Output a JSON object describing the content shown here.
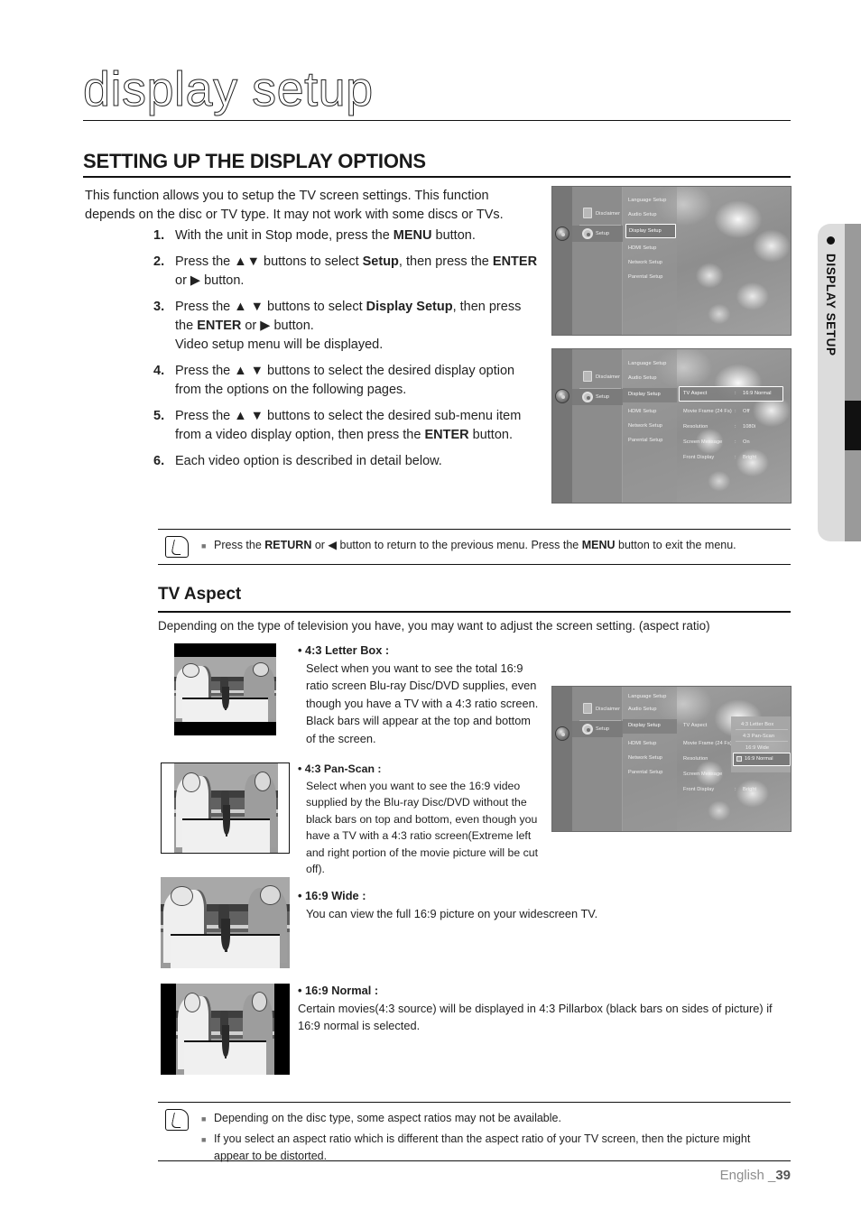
{
  "page": {
    "title": "display setup",
    "section_heading": "SETTING UP THE DISPLAY OPTIONS",
    "intro": "This function allows you to setup the TV screen settings. This function depends on the disc or TV type. It may not work with some discs or TVs.",
    "footer_language": "English _",
    "footer_page": "39",
    "side_tab_label": "DISPLAY SETUP"
  },
  "steps": [
    {
      "num": "1.",
      "text_html": "With the unit in Stop mode, press the <b class=\"b\">MENU</b> button."
    },
    {
      "num": "2.",
      "text_html": "Press the ▲▼ buttons to select <b class=\"b\">Setup</b>, then press the <b class=\"b\">ENTER</b> or ▶ button."
    },
    {
      "num": "3.",
      "text_html": "Press the ▲ ▼ buttons to select <b class=\"b\">Display Setup</b>, then press the <b class=\"b\">ENTER</b> or ▶ button.<br>Video setup menu will be displayed."
    },
    {
      "num": "4.",
      "text_html": "Press the ▲ ▼ buttons to select the desired display option from the options on the following pages."
    },
    {
      "num": "5.",
      "text_html": "Press the ▲ ▼ buttons to select the desired sub-menu item from a video display option, then press the <b class=\"b\">ENTER</b> button."
    },
    {
      "num": "6.",
      "text_html": "Each video option is described in detail below."
    }
  ],
  "note_top": {
    "lines_html": [
      "Press the <b class=\"b\">RETURN</b> or ◀ button to return to the previous menu. Press the <b class=\"b\">MENU</b> button to exit the menu."
    ]
  },
  "note_bottom": {
    "lines_html": [
      "Depending on the disc type, some aspect ratios may not be available.",
      "If you select an aspect ratio which is different than the aspect ratio of your TV screen, then the picture might appear to be distorted."
    ]
  },
  "tv_aspect": {
    "heading": "TV Aspect",
    "intro": "Depending on the type of television you have, you may want to adjust the screen setting. (aspect ratio)",
    "options": [
      {
        "label": "• 4:3 Letter Box :",
        "body": "Select when you want to see the total 16:9 ratio screen Blu-ray Disc/DVD supplies, even though you have a TV with a 4:3 ratio screen. Black bars will appear at the top and bottom of the screen."
      },
      {
        "label": "• 4:3 Pan-Scan :",
        "body": "Select when you want to see the 16:9 video supplied by the Blu-ray Disc/DVD without the black bars on top and bottom, even though you have a TV with a 4:3 ratio screen(Extreme left and right portion of the movie picture will be cut off)."
      },
      {
        "label": "• 16:9 Wide :",
        "body": "You can view the full 16:9 picture on your widescreen TV."
      },
      {
        "label": "• 16:9 Normal :",
        "body": "Certain movies(4:3 source) will be displayed in 4:3 Pillarbox (black bars on sides of picture) if 16:9 normal is selected."
      }
    ]
  },
  "menu_screens": {
    "screen1": {
      "left_items": [
        "Disclaimer",
        "Setup"
      ],
      "mid_items": [
        "Language Setup",
        "Audio Setup",
        "Display Setup",
        "HDMI Setup",
        "Network Setup",
        "Parental Setup"
      ],
      "highlighted": "Display Setup"
    },
    "screen2": {
      "left_items": [
        "Disclaimer",
        "Setup"
      ],
      "mid_items": [
        "Language Setup",
        "Audio Setup",
        "Display Setup",
        "HDMI Setup",
        "Network Setup",
        "Parental Setup"
      ],
      "selected_mid": "Display Setup",
      "right_rows": [
        {
          "label": "TV Aspect",
          "sep": ":",
          "value": "16:9 Normal",
          "highlighted": true
        },
        {
          "label": "Movie Frame (24 Fs)",
          "sep": ":",
          "value": "Off",
          "highlighted": false
        },
        {
          "label": "Resolution",
          "sep": ":",
          "value": "1080i",
          "highlighted": false
        },
        {
          "label": "Screen Message",
          "sep": ":",
          "value": "On",
          "highlighted": false
        },
        {
          "label": "Front Display",
          "sep": ":",
          "value": "Bright",
          "highlighted": false
        }
      ]
    },
    "screen3": {
      "left_items": [
        "Disclaimer",
        "Setup"
      ],
      "mid_items": [
        "Language Setup",
        "Audio Setup",
        "Display Setup",
        "HDMI Setup",
        "Network Setup",
        "Parental Setup"
      ],
      "selected_mid": "Display Setup",
      "right_rows": [
        {
          "label": "TV Aspect",
          "sep": "",
          "value": ""
        },
        {
          "label": "Movie Frame (24 Fs)",
          "sep": "",
          "value": ""
        },
        {
          "label": "Resolution",
          "sep": "",
          "value": ""
        },
        {
          "label": "Screen Message",
          "sep": "",
          "value": ""
        },
        {
          "label": "Front Display",
          "sep": ":",
          "value": "Bright"
        }
      ],
      "dropdown": {
        "options": [
          "4:3 Letter Box",
          "4:3 Pan-Scan",
          "16:9 Wide",
          "16:9 Normal"
        ],
        "selected": "16:9 Normal"
      }
    }
  }
}
